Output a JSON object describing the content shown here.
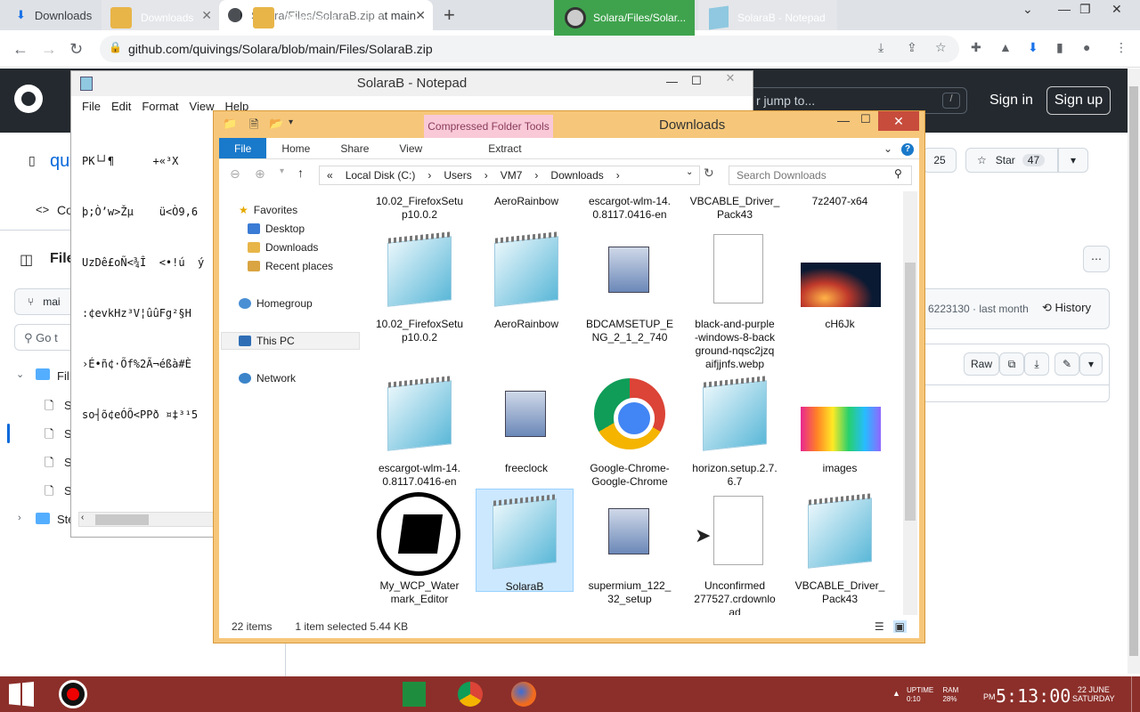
{
  "browser": {
    "tabs": [
      {
        "title": "Downloads"
      },
      {
        "title": "Solara/Files/SolaraB.zip at main"
      }
    ],
    "url": "github.com/quivings/Solara/blob/main/Files/SolaraB.zip"
  },
  "github": {
    "search_placeholder": "r jump to...",
    "slash": "/",
    "sign_in": "Sign in",
    "sign_up": "Sign up",
    "repo_fragment": "qu",
    "code_tab": "Co",
    "files_label": "File",
    "branch": "mai",
    "go_to": "Go t",
    "tree_folder": "Fil",
    "tree_items": [
      "S",
      "S",
      "S",
      "S"
    ],
    "tree_folder2": "Ste",
    "watch_count": "25",
    "star_label": "Star",
    "star_count": "47",
    "commit_info": "6223130 · last month",
    "history": "History",
    "raw": "Raw"
  },
  "notepad": {
    "title": "SolaraB - Notepad",
    "menu": [
      "File",
      "Edit",
      "Format",
      "View",
      "Help"
    ],
    "lines": [
      "PK└┘¶      +«³X",
      "þ;Ò’w>Žµ    ü<Ò9,6",
      "UzDê£oÑ<¾Î  <•!ú  ý",
      ":¢evkHz³V¦ûûFg²§H",
      "›É•ñ¢·Õf%2Ã¬éßà#È",
      "so┤õ¢eÓÕ<PPð ¤‡³¹5"
    ]
  },
  "explorer": {
    "title": "Downloads",
    "context_tab": "Compressed Folder Tools",
    "ribbon": [
      "File",
      "Home",
      "Share",
      "View",
      "Extract"
    ],
    "path": [
      "«",
      "Local Disk (C:)",
      "›",
      "Users",
      "›",
      "VM7",
      "›",
      "Downloads",
      "›"
    ],
    "search_placeholder": "Search Downloads",
    "nav": {
      "favorites": "Favorites",
      "desktop": "Desktop",
      "downloads": "Downloads",
      "recent": "Recent places",
      "homegroup": "Homegroup",
      "thispc": "This PC",
      "network": "Network"
    },
    "top_row": [
      "10.02_FirefoxSetu\np10.0.2",
      "AeroRainbow",
      "escargot-wlm-14.\n0.8117.0416-en",
      "VBCABLE_Driver_\nPack43",
      "7z2407-x64"
    ],
    "files": [
      {
        "name": "10.02_FirefoxSetu\np10.0.2",
        "icon": "notepad-icon"
      },
      {
        "name": "AeroRainbow",
        "icon": "notepad-icon"
      },
      {
        "name": "BDCAMSETUP_E\nNG_2_1_2_740",
        "icon": "installer-icon"
      },
      {
        "name": "black-and-purple\n-windows-8-back\nground-nqsc2jzq\naifjjnfs.webp",
        "icon": "blank-file-icon"
      },
      {
        "name": "cH6Jk",
        "icon": "image-icon"
      },
      {
        "name": "escargot-wlm-14.\n0.8117.0416-en",
        "icon": "notepad-icon"
      },
      {
        "name": "freeclock",
        "icon": "installer-icon"
      },
      {
        "name": "Google-Chrome-\nGoogle-Chrome",
        "icon": "chrome-icon"
      },
      {
        "name": "horizon.setup.2.7.\n6.7",
        "icon": "notepad-icon"
      },
      {
        "name": "images",
        "icon": "image-icon"
      },
      {
        "name": "My_WCP_Water\nmark_Editor",
        "icon": "wcp-icon"
      },
      {
        "name": "SolaraB",
        "icon": "notepad-icon"
      },
      {
        "name": "supermium_122_\n32_setup",
        "icon": "installer-icon"
      },
      {
        "name": "Unconfirmed\n277527.crdownlo\nad",
        "icon": "blank-file-icon"
      },
      {
        "name": "VBCABLE_Driver_\nPack43",
        "icon": "notepad-icon"
      }
    ],
    "status_items": "22 items",
    "status_selected": "1 item selected  5.44 KB"
  },
  "taskbar": {
    "items": [
      "Downloads",
      "Downloads",
      "Solara/Files/Solar...",
      "SolaraB - Notepad"
    ],
    "uptime": "UPTIME\n0:10",
    "ram": "RAM\n28%",
    "ampm": "PM",
    "time": "5:13:00",
    "date": "22 JUNE\nSATURDAY"
  },
  "colors": {
    "accent": "#1979ca",
    "taskbar": "#8c2f2a",
    "explorer_frame": "#f6c77a"
  }
}
